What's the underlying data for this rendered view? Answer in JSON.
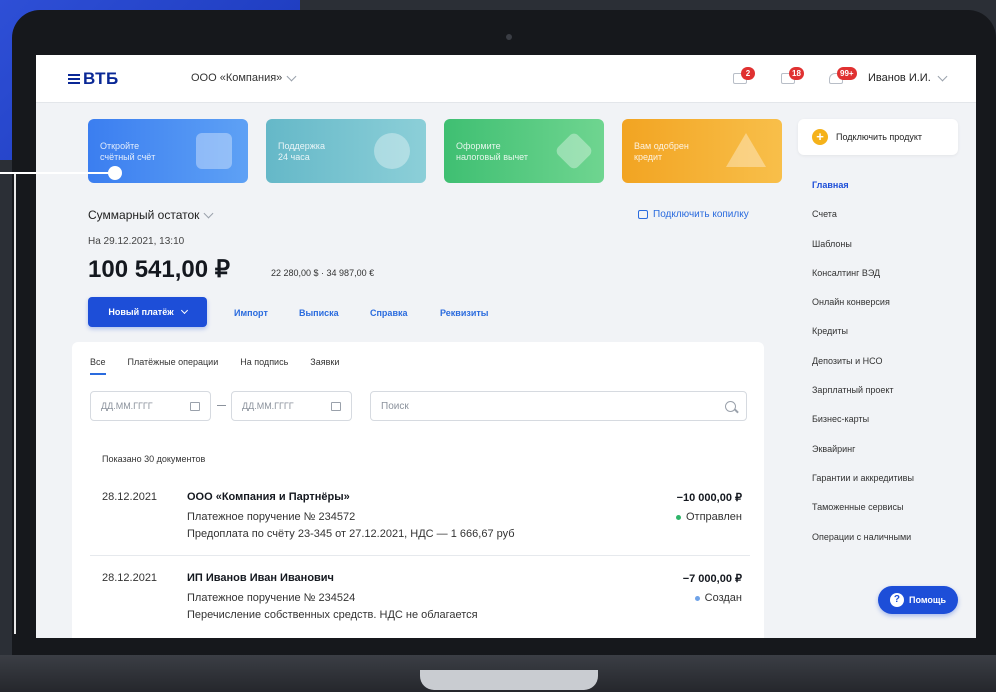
{
  "header": {
    "logo": "ВТБ",
    "company": "ООО «Компания»",
    "notifications": [
      {
        "icon": "mail-icon",
        "badge": "2"
      },
      {
        "icon": "documents-icon",
        "badge": "18"
      },
      {
        "icon": "bell-icon",
        "badge": "99+"
      }
    ],
    "user": "Иванов И.И."
  },
  "promos": [
    {
      "line1": "Откройте",
      "line2": "счётный счёт",
      "color": "#3b7ef0"
    },
    {
      "line1": "Поддержка",
      "line2": "24 часа",
      "color": "#65b8c8"
    },
    {
      "line1": "Оформите",
      "line2": "налоговый вычет",
      "color": "#3fbf72"
    },
    {
      "line1": "Вам одобрен",
      "line2": "кредит",
      "color": "#f2a422"
    }
  ],
  "balance": {
    "title": "Суммарный остаток",
    "date": "На 29.12.2021, 13:10",
    "amount": "100 541,00 ₽",
    "currencies": "22 280,00 $ · 34 987,00 €",
    "piggy": "Подключить копилку"
  },
  "actions": {
    "new_payment": "Новый платёж",
    "import": "Импорт",
    "statement": "Выписка",
    "reference": "Справка",
    "details": "Реквизиты"
  },
  "documents": {
    "tabs": [
      "Все",
      "Платёжные операции",
      "На подпись",
      "Заявки"
    ],
    "date_placeholder": "ДД.ММ.ГГГГ",
    "search_placeholder": "Поиск",
    "shown": "Показано 30 документов",
    "items": [
      {
        "date": "28.12.2021",
        "name": "ООО «Компания и Партнёры»",
        "order": "Платежное поручение № 234572",
        "purpose": "Предоплата по счёту 23-345 от 27.12.2021, НДС — 1 666,67 руб",
        "amount": "−10 000,00 ₽",
        "status": "Отправлен",
        "status_color": "#2fb56a"
      },
      {
        "date": "28.12.2021",
        "name": "ИП Иванов Иван Иванович",
        "order": "Платежное поручение № 234524",
        "purpose": "Перечисление собственных средств. НДС не облагается",
        "amount": "−7 000,00 ₽",
        "status": "Создан",
        "status_color": "#6fa3e8"
      }
    ]
  },
  "sidebar": {
    "connect": "Подключить продукт",
    "items": [
      "Главная",
      "Счета",
      "Шаблоны",
      "Консалтинг ВЭД",
      "Онлайн конверсия",
      "Кредиты",
      "Депозиты и НСО",
      "Зарплатный проект",
      "Бизнес-карты",
      "Эквайринг",
      "Гарантии и аккредитивы",
      "Таможенные сервисы",
      "Операции с наличными"
    ]
  },
  "help": "Помощь"
}
